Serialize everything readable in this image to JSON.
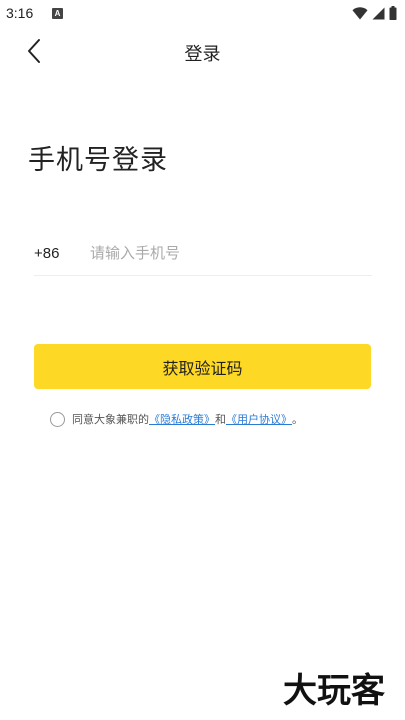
{
  "status_bar": {
    "time": "3:16",
    "a_icon": "A",
    "icons": [
      "notification-a-icon",
      "wifi-icon",
      "signal-icon",
      "battery-icon"
    ]
  },
  "nav": {
    "title": "登录",
    "back_icon": "chevron-left-icon"
  },
  "heading": "手机号登录",
  "phone": {
    "country_code": "+86",
    "placeholder": "请输入手机号",
    "value": ""
  },
  "get_code_button": "获取验证码",
  "agreement": {
    "prefix": "同意大象兼职的",
    "privacy_link": "《隐私政策》",
    "conjunction": "和",
    "terms_link": "《用户协议》",
    "suffix": "。",
    "checked": false
  },
  "watermark": {
    "text": "大玩客",
    "icon": "dawanke-logo"
  },
  "colors": {
    "accent": "#fdd825",
    "link": "#2a7bd6",
    "text": "#222222",
    "placeholder": "#aaaaaa"
  }
}
